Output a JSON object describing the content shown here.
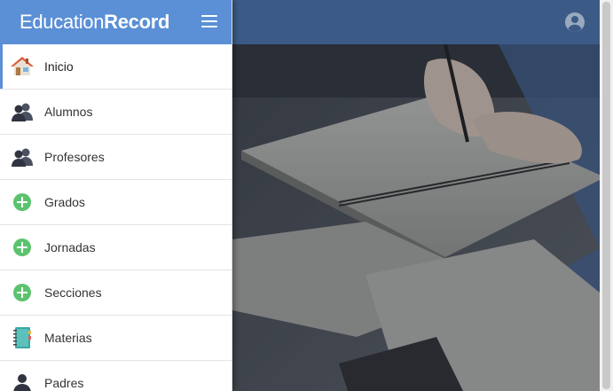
{
  "brand": {
    "light": "Education",
    "bold": "Record"
  },
  "header": {
    "user_icon": "user-circle-icon"
  },
  "sidebar": {
    "items": [
      {
        "label": "Inicio",
        "icon": "home-icon",
        "active": true
      },
      {
        "label": "Alumnos",
        "icon": "users-icon"
      },
      {
        "label": "Profesores",
        "icon": "users-icon"
      },
      {
        "label": "Grados",
        "icon": "plus-circle-icon"
      },
      {
        "label": "Jornadas",
        "icon": "plus-circle-icon"
      },
      {
        "label": "Secciones",
        "icon": "plus-circle-icon"
      },
      {
        "label": "Materias",
        "icon": "notebook-icon"
      },
      {
        "label": "Padres",
        "icon": "user-icon"
      }
    ]
  },
  "colors": {
    "brand_bar": "#5b8fd6",
    "top_bar": "#3b5a86",
    "add_green": "#5cc26e"
  }
}
